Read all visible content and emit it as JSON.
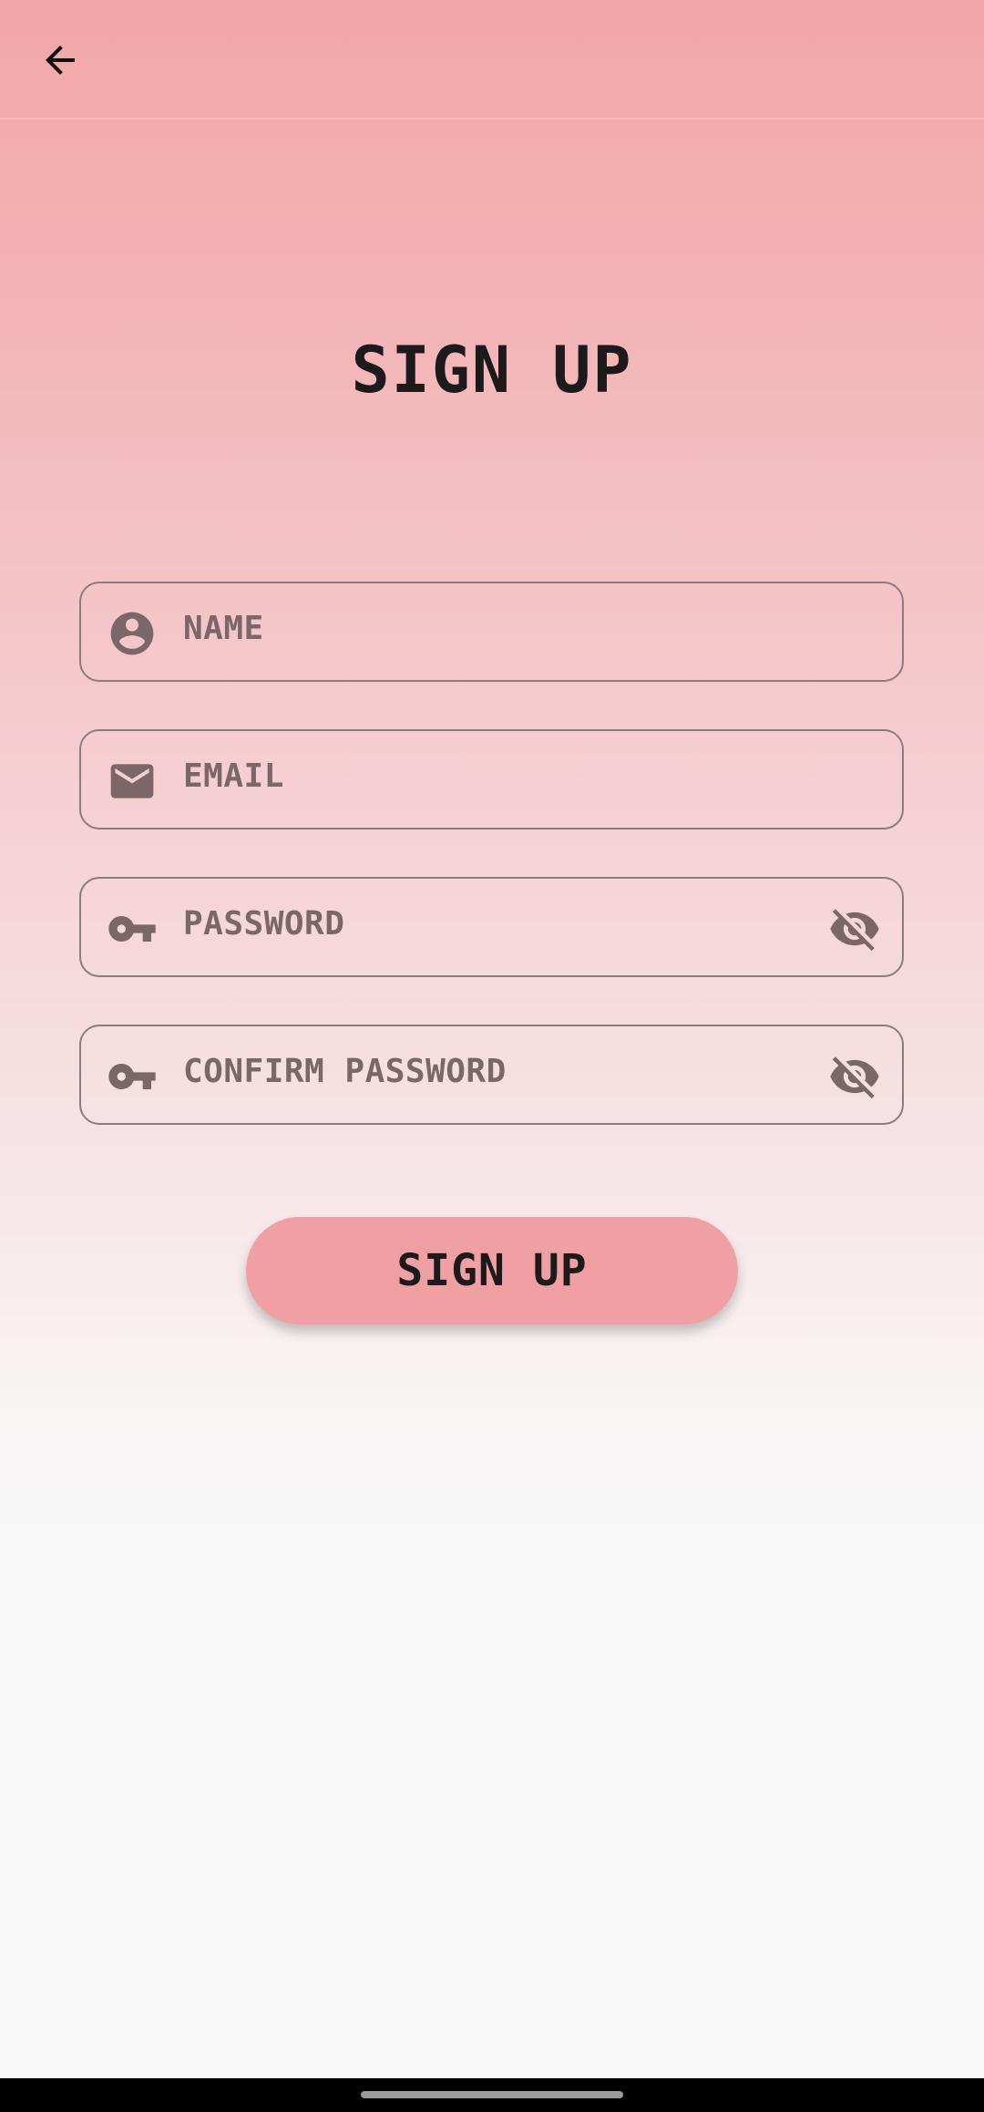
{
  "app_bar": {
    "back_icon": "arrow-back-icon"
  },
  "title": "SIGN UP",
  "fields": [
    {
      "placeholder": "NAME",
      "icon": "account-circle-icon",
      "value": ""
    },
    {
      "placeholder": "EMAIL",
      "icon": "mail-icon",
      "value": ""
    },
    {
      "placeholder": "PASSWORD",
      "icon": "key-icon",
      "trailing_icon": "visibility-off-icon",
      "value": ""
    },
    {
      "placeholder": "CONFIRM PASSWORD",
      "icon": "key-icon",
      "trailing_icon": "visibility-off-icon",
      "value": ""
    }
  ],
  "submit_label": "SIGN UP",
  "colors": {
    "background_top": "#f2a7a7",
    "background_bottom": "#f8f8f8",
    "button": "#f0a0a2",
    "field_border": "#8d7c7e",
    "icon": "#7b6668",
    "text_dark": "#1c1a1b"
  }
}
